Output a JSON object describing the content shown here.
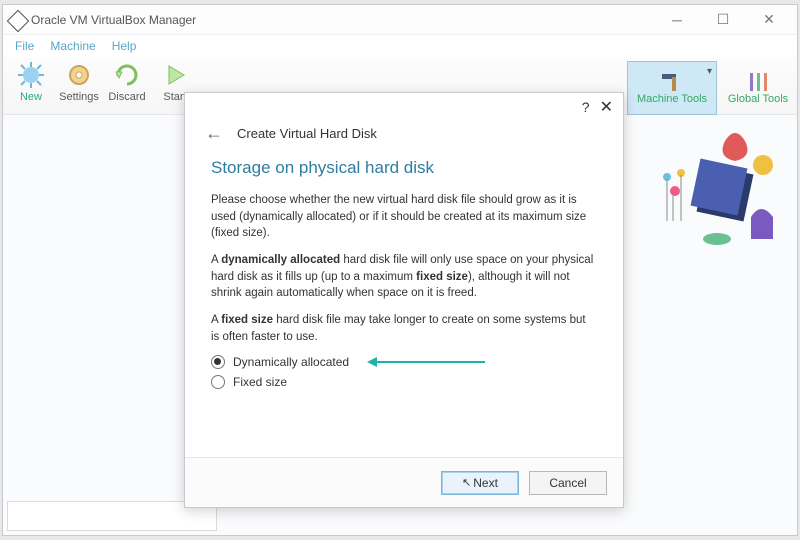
{
  "window": {
    "title": "Oracle VM VirtualBox Manager"
  },
  "menu": {
    "file": "File",
    "machine": "Machine",
    "help": "Help"
  },
  "toolbar": {
    "new": "New",
    "settings": "Settings",
    "discard": "Discard",
    "start": "Start",
    "machine_tools": "Machine Tools",
    "global_tools": "Global Tools"
  },
  "dialog": {
    "title": "Create Virtual Hard Disk",
    "heading": "Storage on physical hard disk",
    "para1": "Please choose whether the new virtual hard disk file should grow as it is used (dynamically allocated) or if it should be created at its maximum size (fixed size).",
    "para2_a": "A ",
    "para2_b": "dynamically allocated",
    "para2_c": " hard disk file will only use space on your physical hard disk as it fills up (up to a maximum ",
    "para2_d": "fixed size",
    "para2_e": "), although it will not shrink again automatically when space on it is freed.",
    "para3_a": "A ",
    "para3_b": "fixed size",
    "para3_c": " hard disk file may take longer to create on some systems but is often faster to use.",
    "radio_dynamic": "Dynamically allocated",
    "radio_fixed": "Fixed size",
    "selected": "dynamic",
    "next": "Next",
    "cancel": "Cancel"
  }
}
